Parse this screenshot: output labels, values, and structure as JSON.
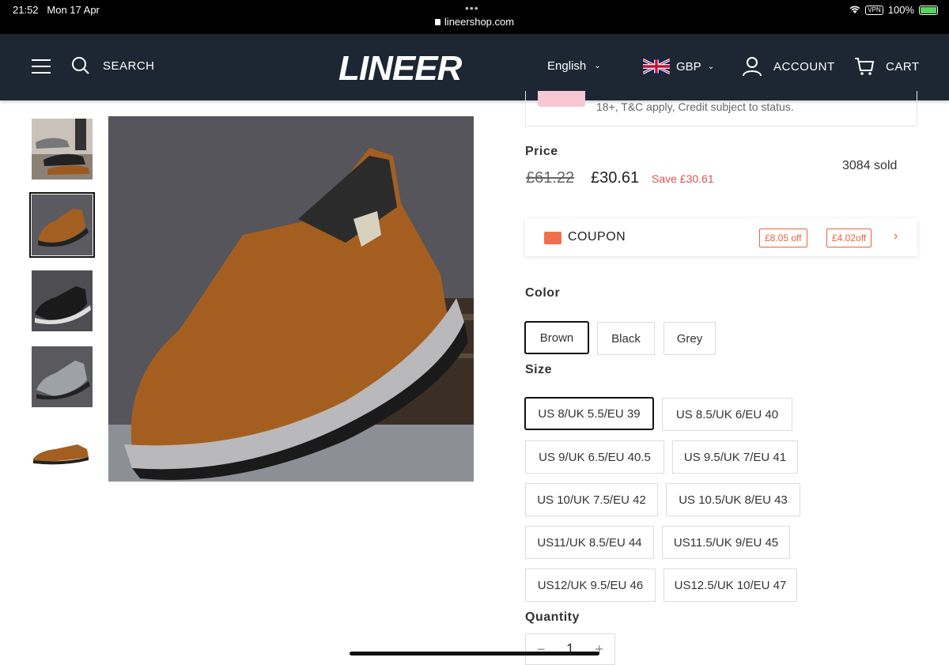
{
  "status_bar": {
    "time": "21:52",
    "date": "Mon 17 Apr",
    "url": "lineershop.com",
    "vpn": "VPN",
    "battery": "100%"
  },
  "nav": {
    "search_label": "SEARCH",
    "logo": "LINEER",
    "language": "English",
    "currency": "GBP",
    "account_label": "ACCOUNT",
    "cart_label": "CART"
  },
  "promo": {
    "text": "18+, T&C apply, Credit subject to status."
  },
  "price": {
    "label": "Price",
    "original": "£61.22",
    "current": "£30.61",
    "save": "Save £30.61",
    "sold": "3084 sold"
  },
  "coupon": {
    "label": "COUPON",
    "tags": [
      "£8.05 off",
      "£4.02off"
    ]
  },
  "color": {
    "label": "Color",
    "options": [
      "Brown",
      "Black",
      "Grey"
    ],
    "selected": "Brown"
  },
  "size": {
    "label": "Size",
    "options": [
      "US 8/UK 5.5/EU 39",
      "US 8.5/UK 6/EU 40",
      "US 9/UK 6.5/EU 40.5",
      "US 9.5/UK 7/EU 41",
      "US 10/UK 7.5/EU 42",
      "US 10.5/UK 8/EU 43",
      "US11/UK 8.5/EU 44",
      "US11.5/UK 9/EU 45",
      "US12/UK 9.5/EU 46",
      "US12.5/UK 10/EU 47"
    ],
    "selected": "US 8/UK 5.5/EU 39"
  },
  "quantity": {
    "label": "Quantity",
    "value": "1",
    "minus": "−",
    "plus": "+"
  },
  "colors": {
    "nav_bg": "#1d2733",
    "accent": "#e8623f",
    "save": "#d9534f"
  }
}
